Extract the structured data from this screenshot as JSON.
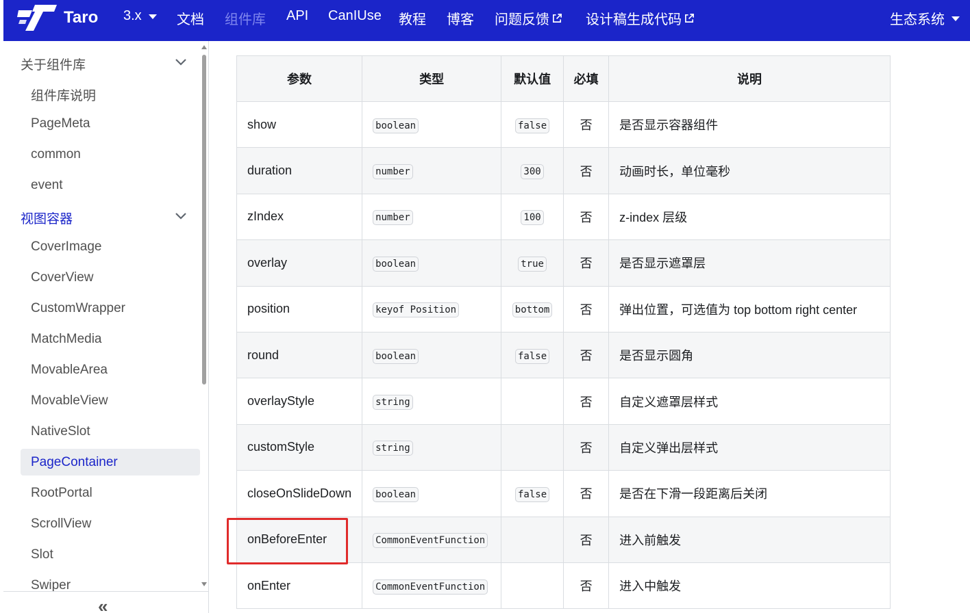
{
  "navbar": {
    "brand": "Taro",
    "items": [
      {
        "label": "3.x",
        "dropdown": true
      },
      {
        "label": "文档"
      },
      {
        "label": "组件库",
        "active": true
      },
      {
        "label": "API"
      },
      {
        "label": "CanIUse"
      },
      {
        "label": "教程"
      },
      {
        "label": "博客"
      },
      {
        "label": "问题反馈",
        "external": true
      },
      {
        "label": "设计稿生成代码",
        "external": true
      }
    ],
    "right": {
      "label": "生态系统",
      "dropdown": true
    },
    "colors": {
      "bg": "#1b25c9",
      "active": "#7f86ee"
    }
  },
  "sidebar": {
    "categories": [
      {
        "label": "关于组件库",
        "items": [
          "组件库说明",
          "PageMeta",
          "common",
          "event"
        ]
      },
      {
        "label": "视图容器",
        "items": [
          "CoverImage",
          "CoverView",
          "CustomWrapper",
          "MatchMedia",
          "MovableArea",
          "MovableView",
          "NativeSlot",
          "PageContainer",
          "RootPortal",
          "ScrollView",
          "Slot",
          "Swiper"
        ]
      }
    ],
    "active_item": "PageContainer",
    "collapse_icon": "«",
    "accent": "#1b25c9"
  },
  "table": {
    "headers": [
      "参数",
      "类型",
      "默认值",
      "必填",
      "说明"
    ],
    "rows": [
      {
        "param": "show",
        "type": "boolean",
        "default": "false",
        "required": "否",
        "desc": "是否显示容器组件"
      },
      {
        "param": "duration",
        "type": "number",
        "default": "300",
        "required": "否",
        "desc": "动画时长，单位毫秒"
      },
      {
        "param": "zIndex",
        "type": "number",
        "default": "100",
        "required": "否",
        "desc": "z-index 层级"
      },
      {
        "param": "overlay",
        "type": "boolean",
        "default": "true",
        "required": "否",
        "desc": "是否显示遮罩层"
      },
      {
        "param": "position",
        "type": "keyof Position",
        "default": "bottom",
        "required": "否",
        "desc": "弹出位置，可选值为 top bottom right center"
      },
      {
        "param": "round",
        "type": "boolean",
        "default": "false",
        "required": "否",
        "desc": "是否显示圆角"
      },
      {
        "param": "overlayStyle",
        "type": "string",
        "default": "",
        "required": "否",
        "desc": "自定义遮罩层样式"
      },
      {
        "param": "customStyle",
        "type": "string",
        "default": "",
        "required": "否",
        "desc": "自定义弹出层样式"
      },
      {
        "param": "closeOnSlideDown",
        "type": "boolean",
        "default": "false",
        "required": "否",
        "desc": "是否在下滑一段距离后关闭"
      },
      {
        "param": "onBeforeEnter",
        "type": "CommonEventFunction",
        "default": "",
        "required": "否",
        "desc": "进入前触发"
      },
      {
        "param": "onEnter",
        "type": "CommonEventFunction",
        "default": "",
        "required": "否",
        "desc": "进入中触发"
      }
    ],
    "highlighted_param": "onBeforeEnter",
    "highlight_color": "#e02b2b"
  }
}
